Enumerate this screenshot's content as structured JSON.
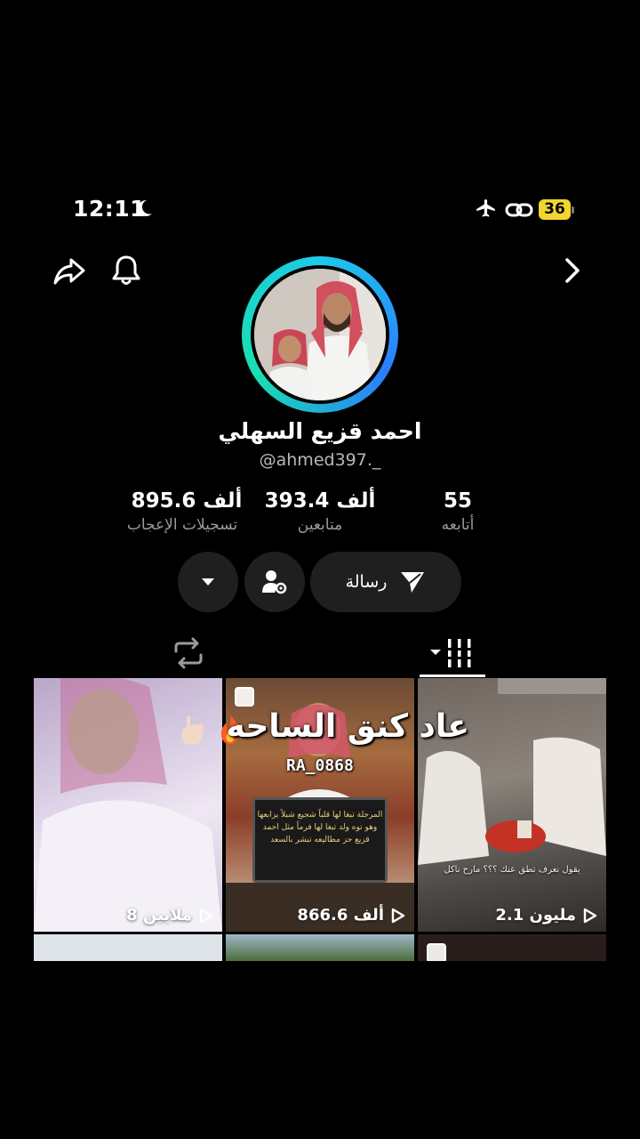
{
  "status_bar": {
    "time": "12:11",
    "battery": "36"
  },
  "profile": {
    "name": "احمد قزيع السهلي",
    "handle": "@ahmed397._"
  },
  "stats": {
    "likes_value": "895.6 ألف",
    "likes_label": "تسجيلات الإعجاب",
    "followers_value": "393.4 ألف",
    "followers_label": "متابعين",
    "following_value": "55",
    "following_label": "أتابعه"
  },
  "actions": {
    "message_label": "رسالة"
  },
  "videos": [
    {
      "views": "8 ملايين"
    },
    {
      "views": "866.6 ألف",
      "plaque": "المرجلة تبغا لها قلباً شجيع شبلاً يزابعها وهو توه ولد تبغا لها فرماً مثل احمد قزيع حز مطاليعه تبشر بالسعد"
    },
    {
      "views": "2.1 مليون",
      "caption": "يقول نعرف تطق عنك ؟؟؟ مارح ناكل"
    }
  ],
  "overlay": {
    "caption": "عاد كنق الساحه",
    "watermark": "RA_0868"
  },
  "icons": {
    "moon": "moon-icon",
    "airplane": "airplane-icon",
    "link": "link-icon",
    "share": "share-icon",
    "bell": "bell-icon",
    "next": "chevron-right-icon",
    "dropdown": "chevron-down-icon",
    "add_friend": "add-friend-settings-icon",
    "send": "send-icon",
    "repost": "repost-icon",
    "videos": "grid-icon"
  },
  "colors": {
    "background": "#000000",
    "button": "#1f1f1f",
    "battery": "#f2d531",
    "ring_start": "#1ec9e8",
    "ring_end": "#19e0b0"
  }
}
